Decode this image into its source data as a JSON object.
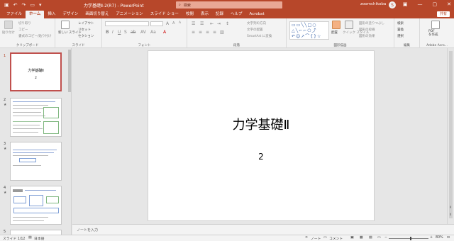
{
  "window": {
    "title": "力学基礎Ⅱ-2(R7)  -  PowerPoint",
    "search_placeholder": "検索",
    "user_name": "zoomchikoba",
    "avatar_initial": "S"
  },
  "ribbon_tabs": [
    "ファイル",
    "ホーム",
    "挿入",
    "デザイン",
    "画面切り替え",
    "アニメーション",
    "スライド ショー",
    "校閲",
    "表示",
    "記録",
    "ヘルプ",
    "Acrobat"
  ],
  "active_tab": "ホーム",
  "share_label": "共有",
  "ribbon": {
    "clipboard": {
      "paste": "貼り付け",
      "cut": "切り取り",
      "copy": "コピー",
      "format_painter": "書式のコピー/貼り付け",
      "label": "クリップボード"
    },
    "slides": {
      "new_slide": "新しい\nスライド",
      "layout": "レイアウト",
      "reset": "リセット",
      "section": "セクション",
      "label": "スライド"
    },
    "font": {
      "label": "フォント"
    },
    "paragraph": {
      "text_direction": "文字列の方向",
      "align_text": "文字の配置",
      "smartart": "SmartArt に変換",
      "label": "段落"
    },
    "drawing": {
      "arrange": "配置",
      "quick_styles": "クイック\nスタイル",
      "shape_fill": "図形の塗りつぶし",
      "shape_outline": "図形の枠線",
      "shape_effects": "図形の効果",
      "label": "図形描画"
    },
    "editing": {
      "find": "検索",
      "replace": "置換",
      "select": "選択",
      "label": "編集"
    },
    "acrobat": {
      "pdf": "PDF\nを作成",
      "label": "Adobe Acro..."
    }
  },
  "thumbnails": [
    {
      "num": "1",
      "title": "力学基礎Ⅱ",
      "subtitle": "2",
      "star": ""
    },
    {
      "num": "2",
      "star": "★"
    },
    {
      "num": "3",
      "star": "★"
    },
    {
      "num": "4",
      "star": "★"
    },
    {
      "num": "5",
      "star": ""
    }
  ],
  "slide": {
    "title": "力学基礎Ⅱ",
    "subtitle": "2"
  },
  "notes_placeholder": "ノートを入力",
  "status": {
    "slide_info": "スライド 1/12",
    "language": "日本語",
    "notes_btn": "ノート",
    "comments_btn": "コメント",
    "zoom": "80%"
  },
  "colors": {
    "accent": "#b7472a",
    "selected_thumb_border": "#c0504d"
  }
}
